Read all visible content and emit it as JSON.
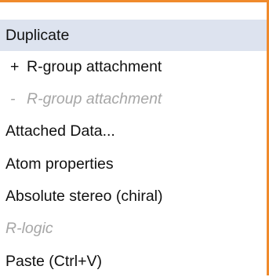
{
  "colors": {
    "border_accent": "#f08a2c",
    "highlight_background": "#dde3ef",
    "disabled_text": "#a6a6a6"
  },
  "context_menu": {
    "items": [
      {
        "label": "Duplicate",
        "prefix": "",
        "state": "highlighted"
      },
      {
        "label": "R-group attachment",
        "prefix": "+",
        "state": "enabled"
      },
      {
        "label": "R-group attachment",
        "prefix": "-",
        "state": "disabled"
      },
      {
        "label": "Attached Data...",
        "prefix": "",
        "state": "enabled"
      },
      {
        "label": "Atom properties",
        "prefix": "",
        "state": "enabled"
      },
      {
        "label": "Absolute stereo (chiral)",
        "prefix": "",
        "state": "enabled"
      },
      {
        "label": "R-logic",
        "prefix": "",
        "state": "disabled"
      },
      {
        "label": "Paste (Ctrl+V)",
        "prefix": "",
        "state": "enabled"
      }
    ]
  }
}
